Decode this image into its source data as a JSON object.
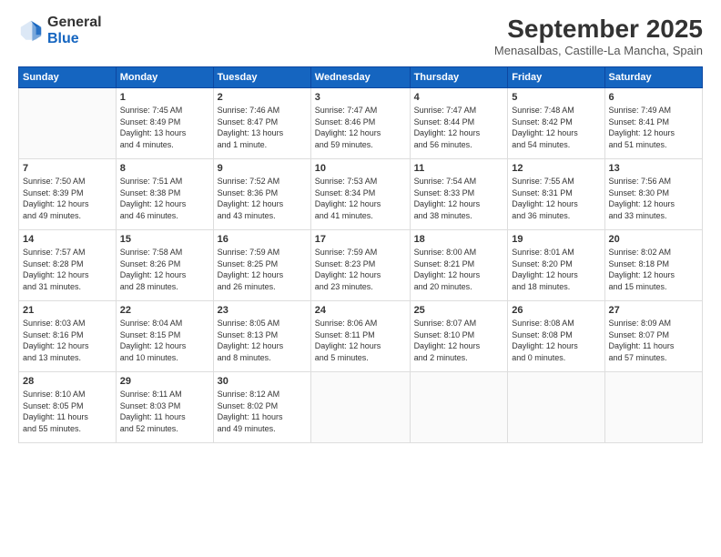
{
  "header": {
    "logo_line1": "General",
    "logo_line2": "Blue",
    "month": "September 2025",
    "location": "Menasalbas, Castille-La Mancha, Spain"
  },
  "weekdays": [
    "Sunday",
    "Monday",
    "Tuesday",
    "Wednesday",
    "Thursday",
    "Friday",
    "Saturday"
  ],
  "weeks": [
    [
      {
        "day": "",
        "info": ""
      },
      {
        "day": "1",
        "info": "Sunrise: 7:45 AM\nSunset: 8:49 PM\nDaylight: 13 hours\nand 4 minutes."
      },
      {
        "day": "2",
        "info": "Sunrise: 7:46 AM\nSunset: 8:47 PM\nDaylight: 13 hours\nand 1 minute."
      },
      {
        "day": "3",
        "info": "Sunrise: 7:47 AM\nSunset: 8:46 PM\nDaylight: 12 hours\nand 59 minutes."
      },
      {
        "day": "4",
        "info": "Sunrise: 7:47 AM\nSunset: 8:44 PM\nDaylight: 12 hours\nand 56 minutes."
      },
      {
        "day": "5",
        "info": "Sunrise: 7:48 AM\nSunset: 8:42 PM\nDaylight: 12 hours\nand 54 minutes."
      },
      {
        "day": "6",
        "info": "Sunrise: 7:49 AM\nSunset: 8:41 PM\nDaylight: 12 hours\nand 51 minutes."
      }
    ],
    [
      {
        "day": "7",
        "info": "Sunrise: 7:50 AM\nSunset: 8:39 PM\nDaylight: 12 hours\nand 49 minutes."
      },
      {
        "day": "8",
        "info": "Sunrise: 7:51 AM\nSunset: 8:38 PM\nDaylight: 12 hours\nand 46 minutes."
      },
      {
        "day": "9",
        "info": "Sunrise: 7:52 AM\nSunset: 8:36 PM\nDaylight: 12 hours\nand 43 minutes."
      },
      {
        "day": "10",
        "info": "Sunrise: 7:53 AM\nSunset: 8:34 PM\nDaylight: 12 hours\nand 41 minutes."
      },
      {
        "day": "11",
        "info": "Sunrise: 7:54 AM\nSunset: 8:33 PM\nDaylight: 12 hours\nand 38 minutes."
      },
      {
        "day": "12",
        "info": "Sunrise: 7:55 AM\nSunset: 8:31 PM\nDaylight: 12 hours\nand 36 minutes."
      },
      {
        "day": "13",
        "info": "Sunrise: 7:56 AM\nSunset: 8:30 PM\nDaylight: 12 hours\nand 33 minutes."
      }
    ],
    [
      {
        "day": "14",
        "info": "Sunrise: 7:57 AM\nSunset: 8:28 PM\nDaylight: 12 hours\nand 31 minutes."
      },
      {
        "day": "15",
        "info": "Sunrise: 7:58 AM\nSunset: 8:26 PM\nDaylight: 12 hours\nand 28 minutes."
      },
      {
        "day": "16",
        "info": "Sunrise: 7:59 AM\nSunset: 8:25 PM\nDaylight: 12 hours\nand 26 minutes."
      },
      {
        "day": "17",
        "info": "Sunrise: 7:59 AM\nSunset: 8:23 PM\nDaylight: 12 hours\nand 23 minutes."
      },
      {
        "day": "18",
        "info": "Sunrise: 8:00 AM\nSunset: 8:21 PM\nDaylight: 12 hours\nand 20 minutes."
      },
      {
        "day": "19",
        "info": "Sunrise: 8:01 AM\nSunset: 8:20 PM\nDaylight: 12 hours\nand 18 minutes."
      },
      {
        "day": "20",
        "info": "Sunrise: 8:02 AM\nSunset: 8:18 PM\nDaylight: 12 hours\nand 15 minutes."
      }
    ],
    [
      {
        "day": "21",
        "info": "Sunrise: 8:03 AM\nSunset: 8:16 PM\nDaylight: 12 hours\nand 13 minutes."
      },
      {
        "day": "22",
        "info": "Sunrise: 8:04 AM\nSunset: 8:15 PM\nDaylight: 12 hours\nand 10 minutes."
      },
      {
        "day": "23",
        "info": "Sunrise: 8:05 AM\nSunset: 8:13 PM\nDaylight: 12 hours\nand 8 minutes."
      },
      {
        "day": "24",
        "info": "Sunrise: 8:06 AM\nSunset: 8:11 PM\nDaylight: 12 hours\nand 5 minutes."
      },
      {
        "day": "25",
        "info": "Sunrise: 8:07 AM\nSunset: 8:10 PM\nDaylight: 12 hours\nand 2 minutes."
      },
      {
        "day": "26",
        "info": "Sunrise: 8:08 AM\nSunset: 8:08 PM\nDaylight: 12 hours\nand 0 minutes."
      },
      {
        "day": "27",
        "info": "Sunrise: 8:09 AM\nSunset: 8:07 PM\nDaylight: 11 hours\nand 57 minutes."
      }
    ],
    [
      {
        "day": "28",
        "info": "Sunrise: 8:10 AM\nSunset: 8:05 PM\nDaylight: 11 hours\nand 55 minutes."
      },
      {
        "day": "29",
        "info": "Sunrise: 8:11 AM\nSunset: 8:03 PM\nDaylight: 11 hours\nand 52 minutes."
      },
      {
        "day": "30",
        "info": "Sunrise: 8:12 AM\nSunset: 8:02 PM\nDaylight: 11 hours\nand 49 minutes."
      },
      {
        "day": "",
        "info": ""
      },
      {
        "day": "",
        "info": ""
      },
      {
        "day": "",
        "info": ""
      },
      {
        "day": "",
        "info": ""
      }
    ]
  ]
}
